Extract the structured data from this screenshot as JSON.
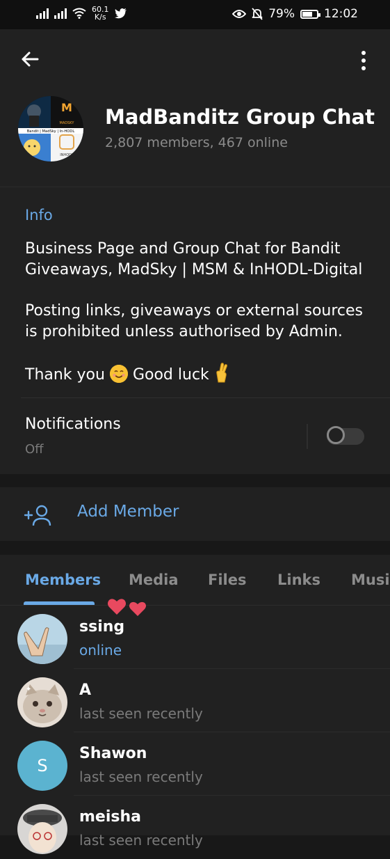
{
  "status_bar": {
    "net_speed": "60.1",
    "net_unit": "K/s",
    "battery": "79%",
    "battery_level": 0.79,
    "time": "12:02"
  },
  "header": {
    "title": "MadBanditz Group Chat",
    "subtitle": "2,807 members, 467 online",
    "avatar_texts": [
      "Bandit | MadSky | In-HODL",
      "MADSKY",
      "INHODL"
    ]
  },
  "info": {
    "label": "Info",
    "paragraph1": "Business Page and Group Chat for Bandit Giveaways, MadSky | MSM & InHODL-Digital",
    "paragraph2": "Posting links, giveaways or external sources is prohibited unless authorised by Admin.",
    "paragraph3a": "Thank you",
    "paragraph3b": "Good luck"
  },
  "notifications": {
    "label": "Notifications",
    "value": "Off",
    "enabled": false
  },
  "add_member": {
    "label": "Add Member"
  },
  "tabs": [
    {
      "label": "Members",
      "active": true
    },
    {
      "label": "Media"
    },
    {
      "label": "Files"
    },
    {
      "label": "Links"
    },
    {
      "label": "Music"
    }
  ],
  "members": [
    {
      "name": "ssing",
      "status": "online"
    },
    {
      "name": "A",
      "status": "last seen recently"
    },
    {
      "name": "Shawon",
      "status": "last seen recently",
      "initial": "S"
    },
    {
      "name": "meisha",
      "status": "last seen recently"
    }
  ],
  "colors": {
    "accent": "#6aa9e6",
    "background": "#212121",
    "initial_avatar": "#5bb3d0"
  }
}
